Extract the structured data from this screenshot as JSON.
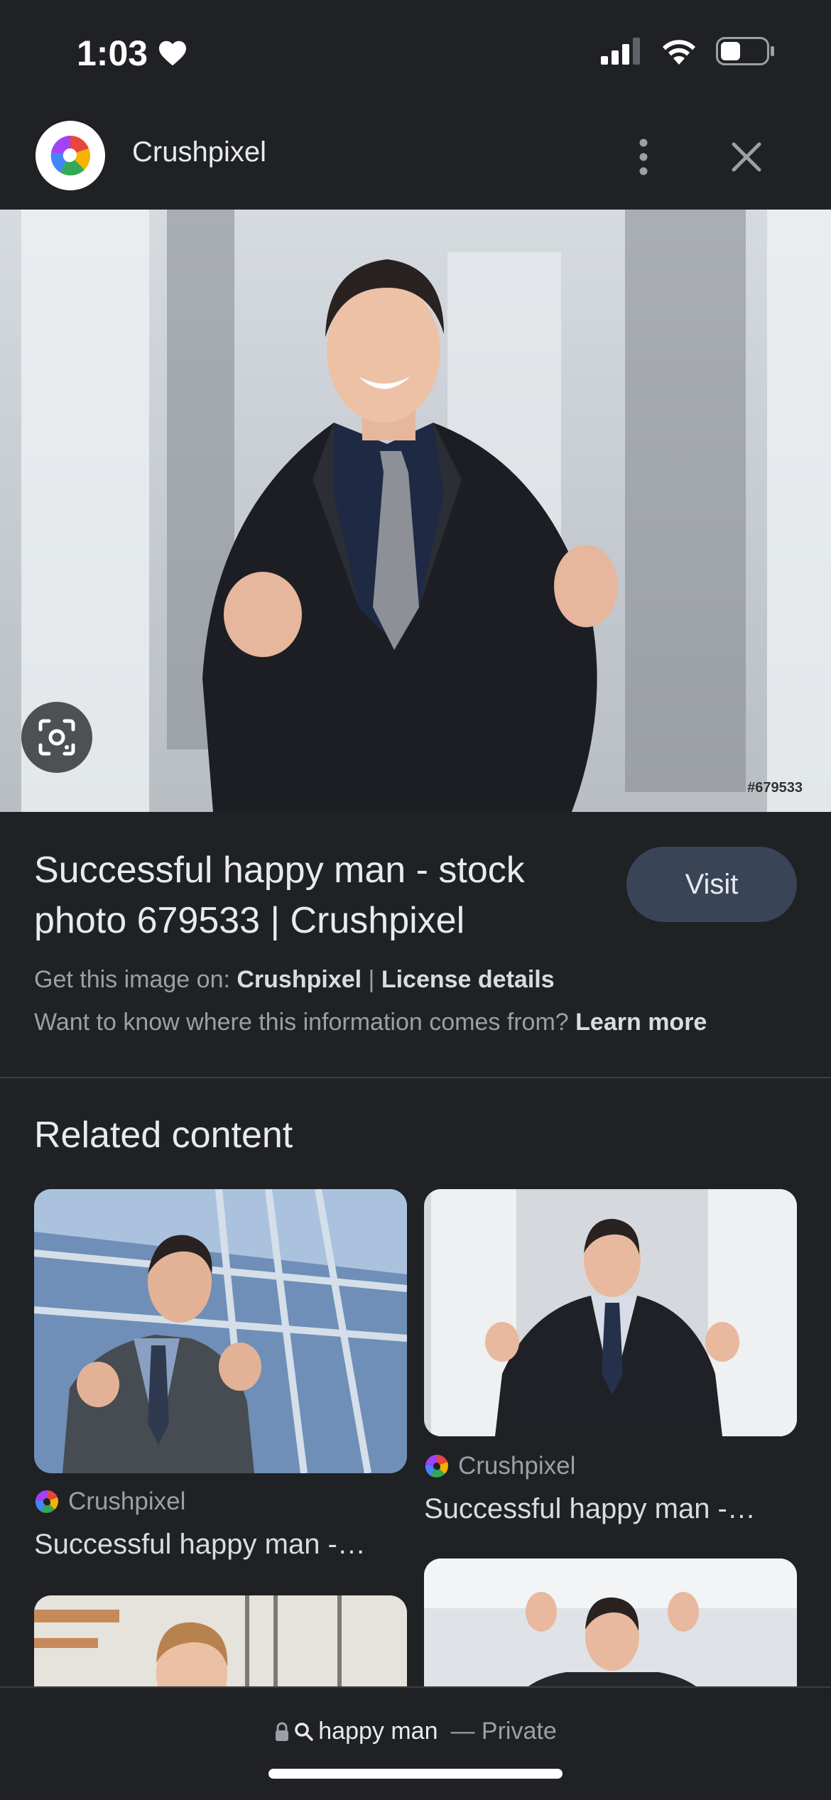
{
  "status_bar": {
    "time": "1:03",
    "battery_percent": 40
  },
  "header": {
    "site_name": "Crushpixel"
  },
  "hero": {
    "image_id": "#679533"
  },
  "result": {
    "title": "Successful happy man - stock photo 679533 | Crushpixel",
    "visit_label": "Visit",
    "get_image_prefix": "Get this image on:",
    "get_image_source": "Crushpixel",
    "separator": "|",
    "license_label": "License details",
    "info_question": "Want to know where this information comes from?",
    "learn_more": "Learn more"
  },
  "related": {
    "heading": "Related content",
    "items": [
      {
        "source": "Crushpixel",
        "title": "Successful happy man -…"
      },
      {
        "source": "Crushpixel",
        "title": "Successful happy man -…"
      },
      {
        "source": "",
        "title": ""
      },
      {
        "source": "",
        "title": ""
      }
    ]
  },
  "address_bar": {
    "query": "happy man",
    "mode": "— Private"
  },
  "colors": {
    "background": "#202124",
    "visit_button": "#394457",
    "text_primary": "#e8eaed",
    "text_secondary": "#9aa0a6"
  }
}
